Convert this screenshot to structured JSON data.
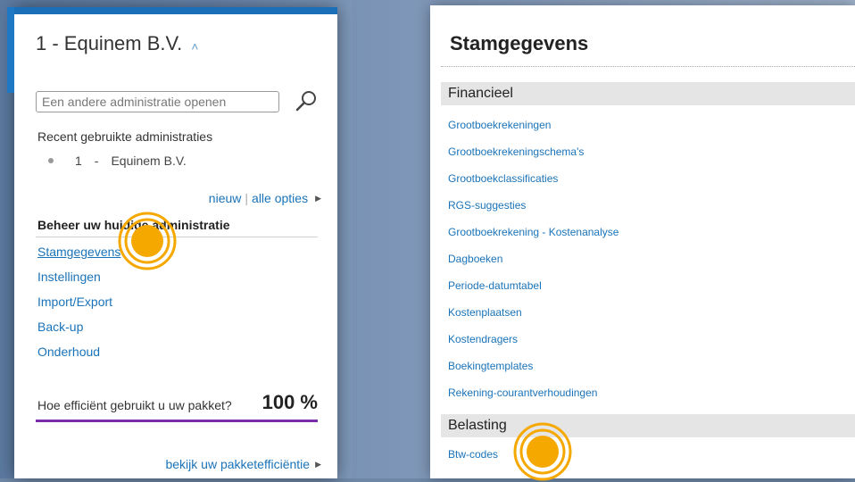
{
  "left_panel": {
    "company_title": "1 - Equinem B.V.",
    "search_placeholder": "Een andere administratie openen",
    "recent_title": "Recent gebruikte administraties",
    "recent_items": [
      {
        "number": "1",
        "dash": "-",
        "name": "Equinem B.V."
      }
    ],
    "links": {
      "new": "nieuw",
      "separator": "|",
      "all_options": "alle opties"
    },
    "section_title": "Beheer uw huidige administratie",
    "menu": [
      {
        "label": "Stamgegevens"
      },
      {
        "label": "Instellingen"
      },
      {
        "label": "Import/Export"
      },
      {
        "label": "Back-up"
      },
      {
        "label": "Onderhoud"
      }
    ],
    "efficiency_question": "Hoe efficiënt gebruikt u uw pakket?",
    "efficiency_value": "100 %",
    "efficiency_fraction": 1.0,
    "bottom_link": "bekijk uw pakketefficiëntie"
  },
  "right_panel": {
    "title": "Stamgegevens",
    "groups": [
      {
        "name": "Financieel",
        "items": [
          "Grootboekrekeningen",
          "Grootboekrekeningschema's",
          "Grootboekclassificaties",
          "RGS-suggesties",
          "Grootboekrekening - Kostenanalyse",
          "Dagboeken",
          "Periode-datumtabel",
          "Kostenplaatsen",
          "Kostendragers",
          "Boekingtemplates",
          "Rekening-courantverhoudingen"
        ]
      },
      {
        "name": "Belasting",
        "items": [
          "Btw-codes"
        ]
      }
    ]
  },
  "colors": {
    "accent_blue": "#1a73b8",
    "efficiency_bar": "#7a2da8",
    "click_marker": "#f5a800"
  }
}
